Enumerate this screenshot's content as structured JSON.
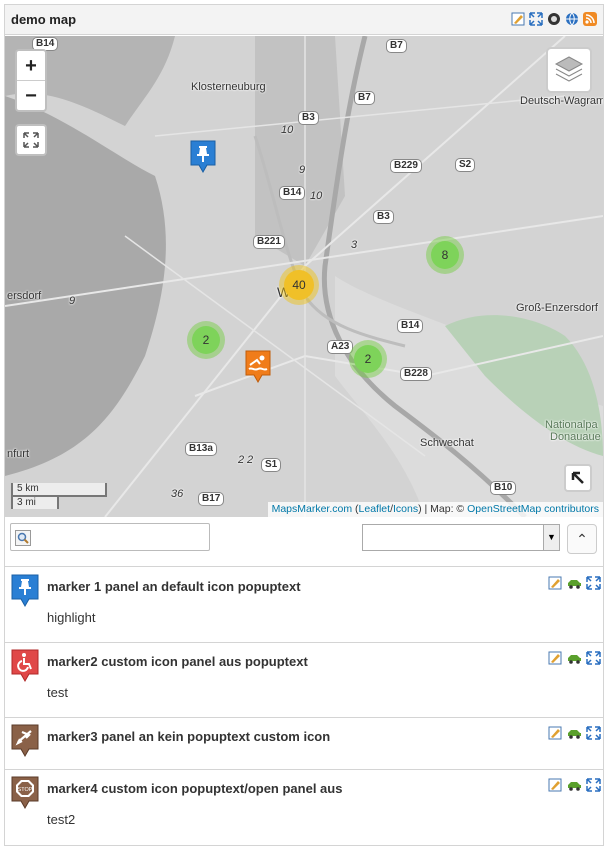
{
  "title": "demo map",
  "header_icons": [
    "edit-icon",
    "fullscreen-icon",
    "kml-icon",
    "globe-icon",
    "rss-icon"
  ],
  "map": {
    "zoom_in": "+",
    "zoom_out": "−",
    "places": [
      {
        "name": "Klosterneuburg"
      },
      {
        "name": "Deutsch-Wagram"
      },
      {
        "name": "Wien"
      },
      {
        "name": "Groß-Enzersdorf"
      },
      {
        "name": "Schwechat"
      },
      {
        "name": "ersdorf"
      },
      {
        "name": "nfurt"
      },
      {
        "name": "Nationalpa"
      },
      {
        "name": "Donauaue"
      }
    ],
    "road_labels": [
      "B14",
      "B7",
      "B7",
      "B3",
      "B229",
      "S2",
      "B14",
      "B3",
      "B221",
      "B14",
      "A23",
      "B228",
      "B13a",
      "S1",
      "B17",
      "B10"
    ],
    "small_numbers": [
      "10",
      "9",
      "3",
      "9",
      "10",
      "36",
      "2",
      "2"
    ],
    "clusters": [
      {
        "count": "40",
        "color": "#f0c028"
      },
      {
        "count": "8",
        "color": "#7ed35a"
      },
      {
        "count": "2",
        "color": "#7ed35a"
      },
      {
        "count": "2",
        "color": "#7ed35a"
      }
    ],
    "scale_km": "5 km",
    "scale_mi": "3 mi",
    "attribution": {
      "mapsmarker": "MapsMarker.com",
      "leaflet": "Leaflet",
      "icons": "Icons",
      "map_prefix": "| Map: ©",
      "osm": "OpenStreetMap contributors"
    }
  },
  "toolbar": {
    "search_value": "",
    "select_value": "",
    "up_label": "⌃"
  },
  "markers": [
    {
      "name": "marker 1 panel an default icon popuptext",
      "desc": "highlight",
      "icon": "pushpin-icon",
      "color": "#2a7fd4"
    },
    {
      "name": "marker2 custom icon panel aus popuptext",
      "desc": "test",
      "icon": "wheelchair-icon",
      "color": "#e04848"
    },
    {
      "name": "marker3 panel an kein popuptext custom icon",
      "desc": "",
      "icon": "airplane-icon",
      "color": "#8a6148"
    },
    {
      "name": "marker4 custom icon popuptext/open panel aus",
      "desc": "test2",
      "icon": "stop-sign-icon",
      "color": "#8a6148"
    }
  ]
}
